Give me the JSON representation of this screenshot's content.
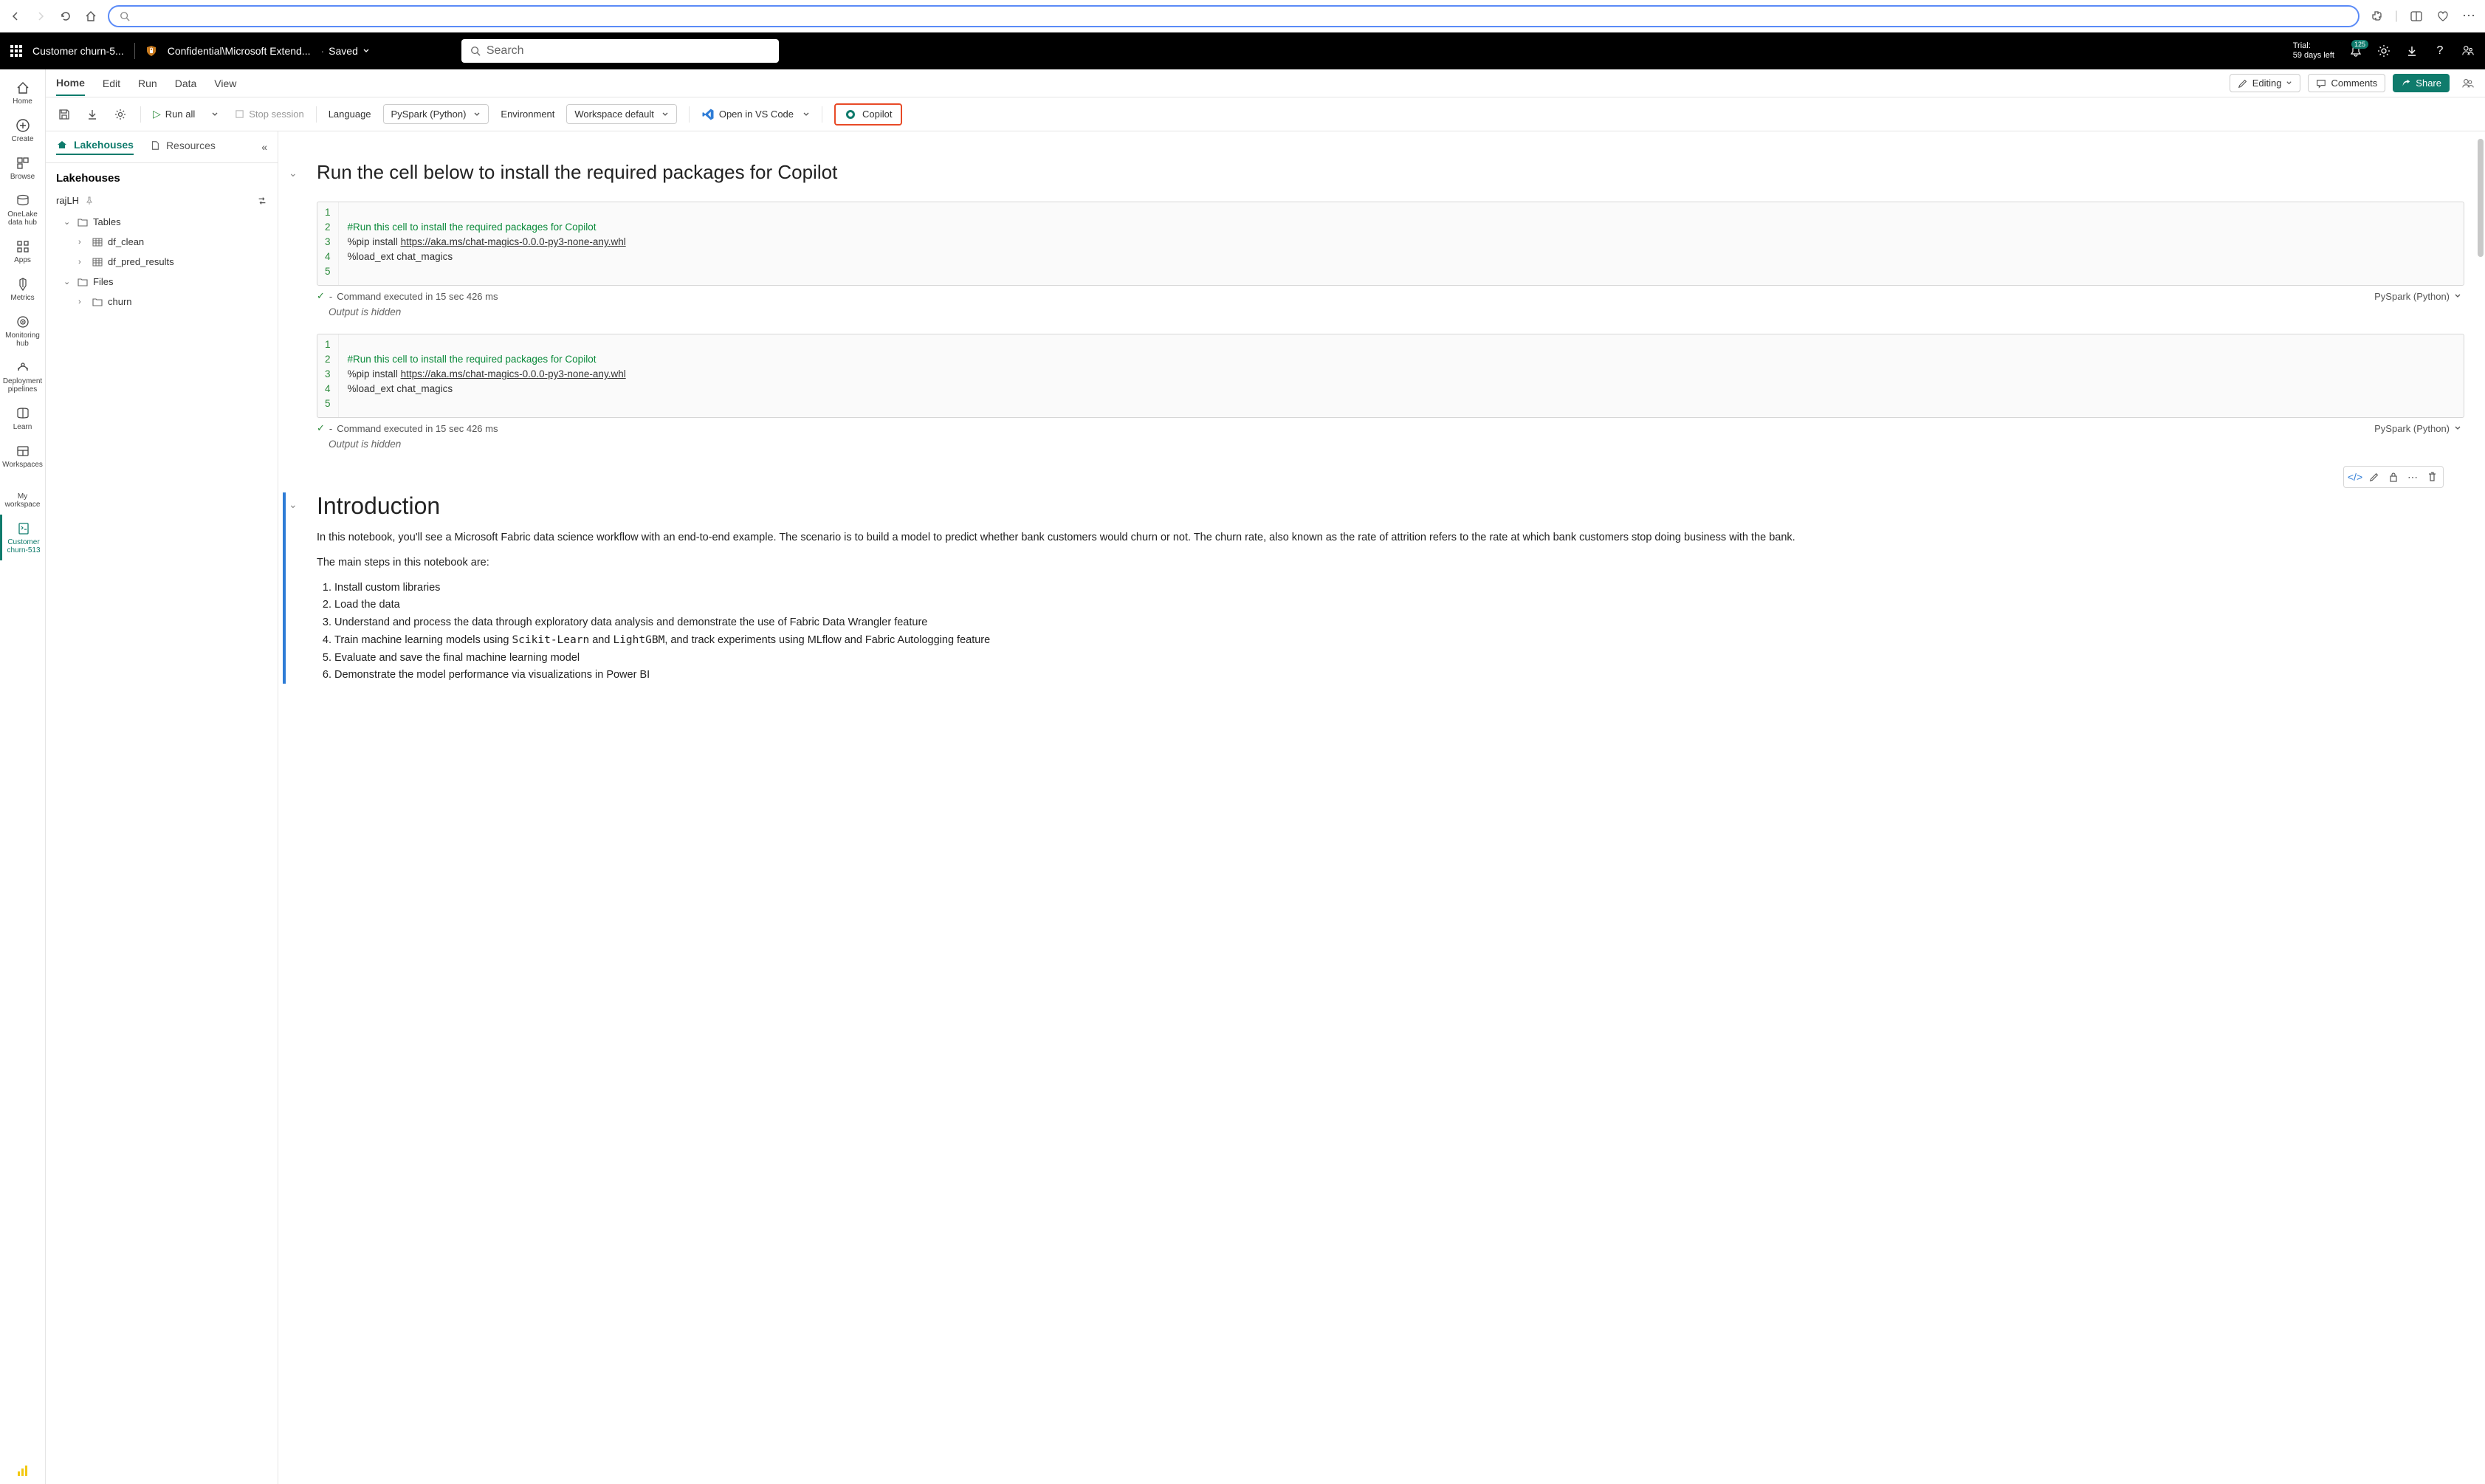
{
  "browser": {
    "search_placeholder": ""
  },
  "topbar": {
    "title": "Customer churn-5...",
    "confidential": "Confidential\\Microsoft Extend...",
    "saved": "Saved",
    "search_placeholder": "Search",
    "trial_line1": "Trial:",
    "trial_line2": "59 days left",
    "notif_count": "125"
  },
  "rail": {
    "home": "Home",
    "create": "Create",
    "browse": "Browse",
    "onelake": "OneLake data hub",
    "apps": "Apps",
    "metrics": "Metrics",
    "monitoring": "Monitoring hub",
    "pipelines": "Deployment pipelines",
    "learn": "Learn",
    "workspaces": "Workspaces",
    "my_workspace": "My workspace",
    "active_item": "Customer churn-513"
  },
  "ribbon": {
    "tabs": [
      "Home",
      "Edit",
      "Run",
      "Data",
      "View"
    ],
    "editing": "Editing",
    "comments": "Comments",
    "share": "Share"
  },
  "toolbar": {
    "run_all": "Run all",
    "stop_session": "Stop session",
    "language_label": "Language",
    "language_value": "PySpark (Python)",
    "env_label": "Environment",
    "env_value": "Workspace default",
    "open_vscode": "Open in VS Code",
    "copilot": "Copilot"
  },
  "explorer": {
    "tabs": {
      "lakehouses": "Lakehouses",
      "resources": "Resources"
    },
    "heading": "Lakehouses",
    "lakehouse": "rajLH",
    "tables": "Tables",
    "table_items": [
      "df_clean",
      "df_pred_results"
    ],
    "files": "Files",
    "file_items": [
      "churn"
    ]
  },
  "notebook": {
    "cell1": {
      "heading": "Run the cell below to install the required packages for Copilot"
    },
    "code_cell": {
      "comment": "#Run this cell to install the required packages for Copilot",
      "pip_cmd": "%pip install ",
      "pip_url": "https://aka.ms/chat-magics-0.0.0-py3-none-any.whl",
      "load_ext": "%load_ext chat_magics",
      "status_prefix": "- ",
      "status_text": "Command executed in 15 sec 426 ms",
      "lang": "PySpark (Python)",
      "output_hidden": "Output is hidden"
    },
    "intro": {
      "heading": "Introduction",
      "p1": "In this notebook, you'll see a Microsoft Fabric data science workflow with an end-to-end example. The scenario is to build a model to predict whether bank customers would churn or not. The churn rate, also known as the rate of attrition refers to the rate at which bank customers stop doing business with the bank.",
      "p2": "The main steps in this notebook are:",
      "steps": {
        "s1": "Install custom libraries",
        "s2": "Load the data",
        "s3": "Understand and process the data through exploratory data analysis and demonstrate the use of Fabric Data Wrangler feature",
        "s4_a": "Train machine learning models using ",
        "s4_b": "Scikit-Learn",
        "s4_c": " and ",
        "s4_d": "LightGBM",
        "s4_e": ", and track experiments using MLflow and Fabric Autologging feature",
        "s5": "Evaluate and save the final machine learning model",
        "s6": "Demonstrate the model performance via visualizations in Power BI"
      }
    }
  }
}
